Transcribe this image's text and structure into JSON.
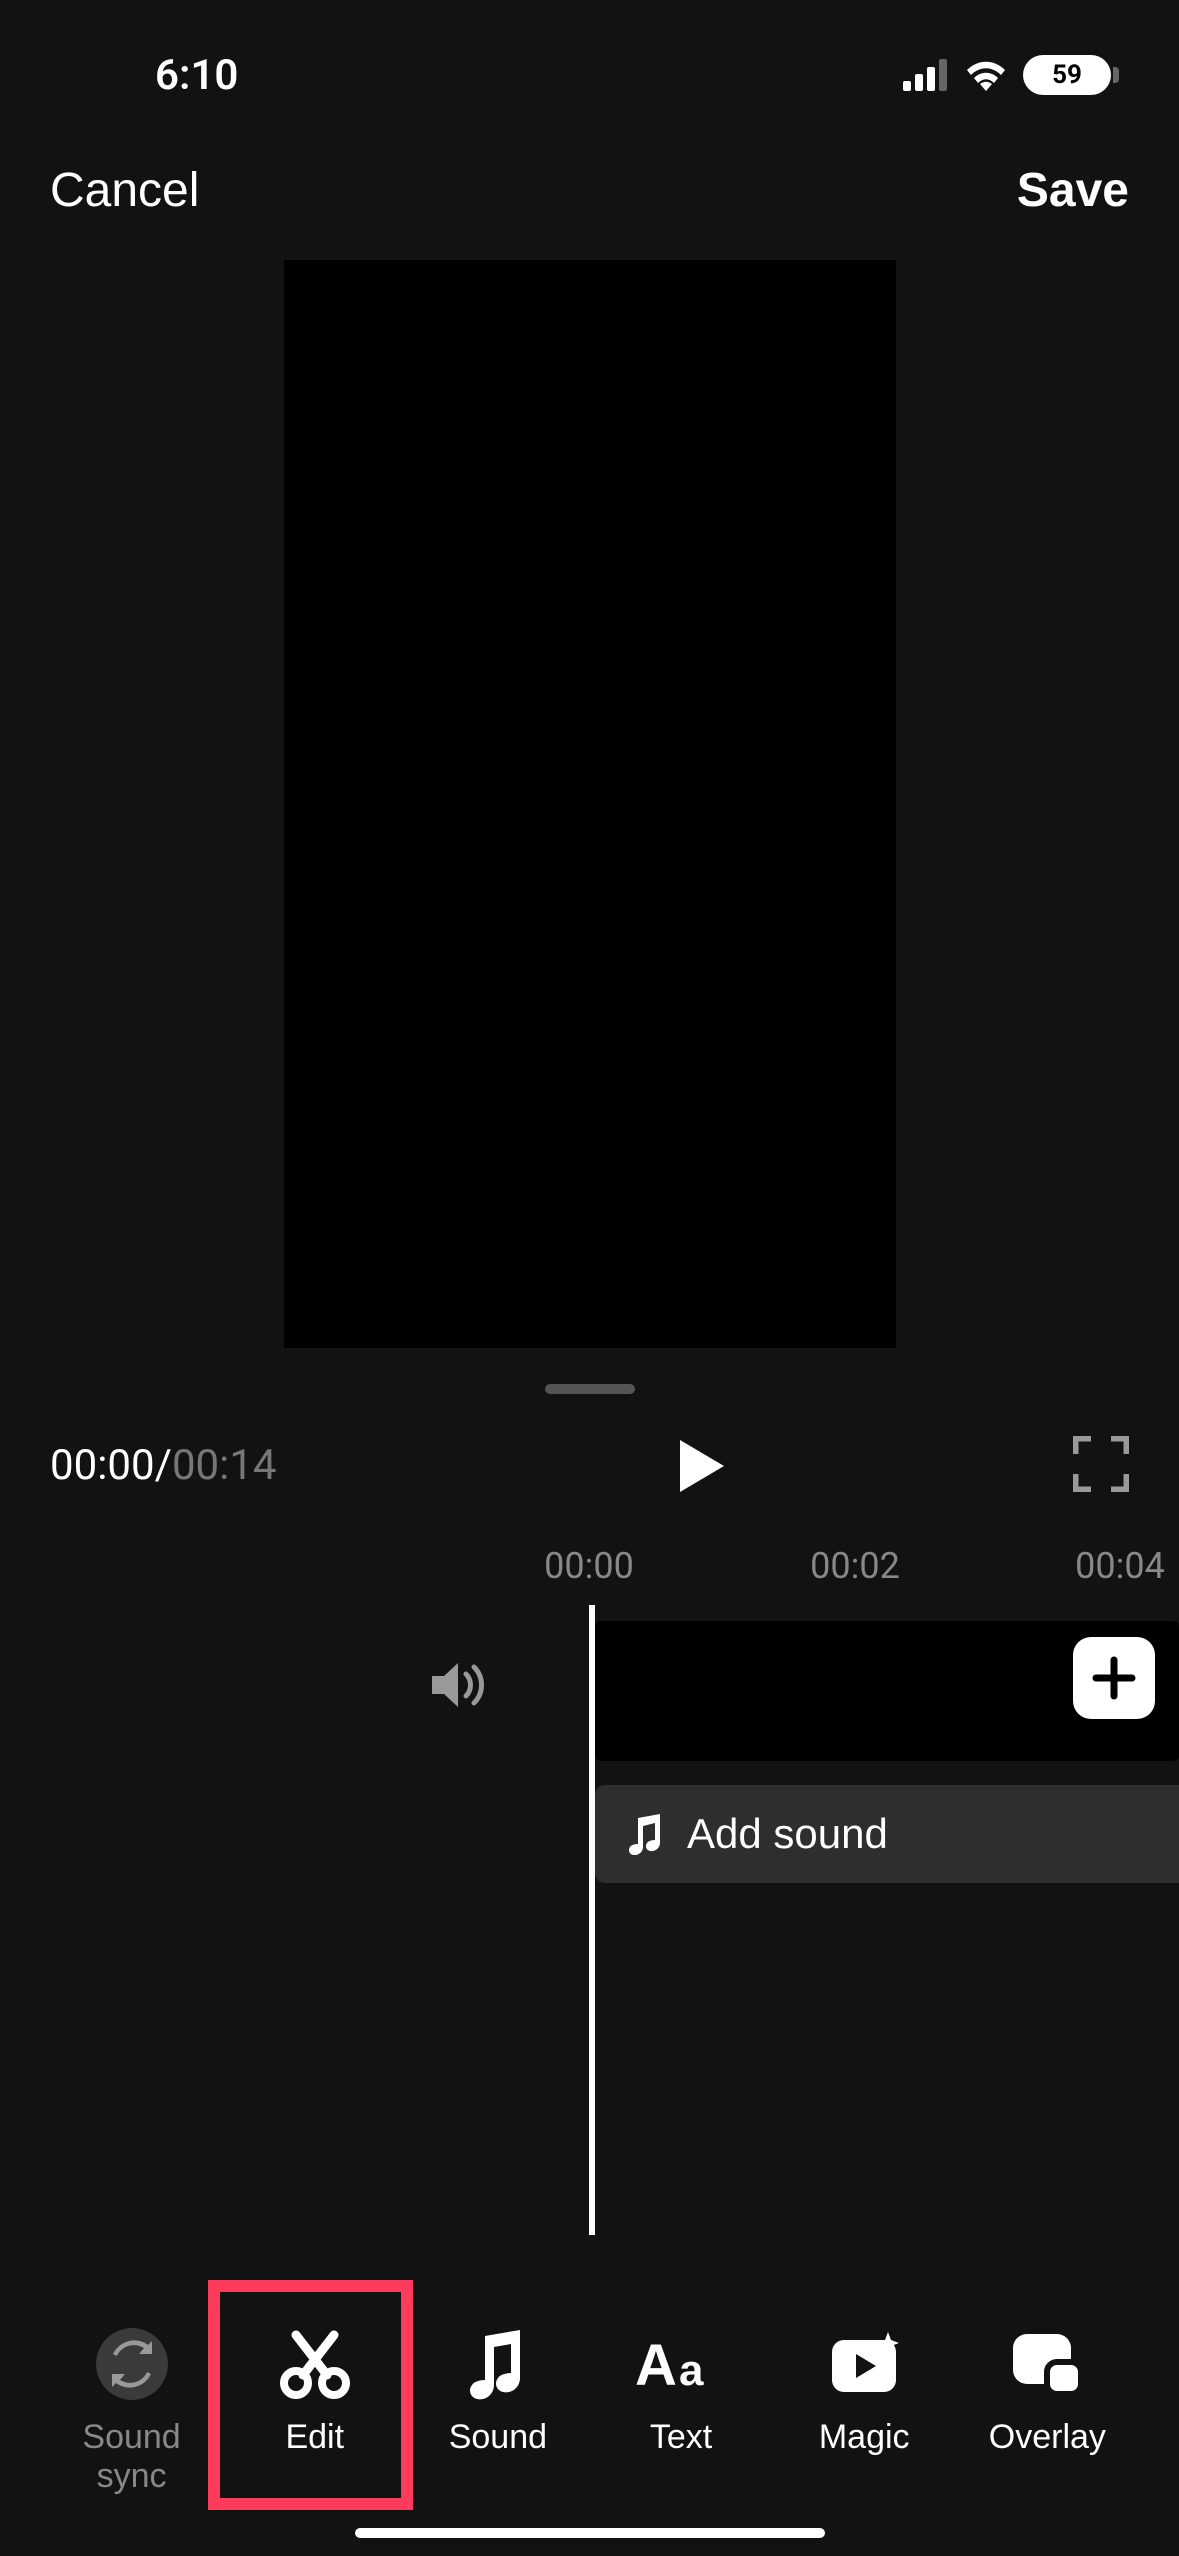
{
  "statusBar": {
    "time": "6:10",
    "battery": "59"
  },
  "header": {
    "cancel": "Cancel",
    "save": "Save"
  },
  "playback": {
    "current": "00:00",
    "separator": "/",
    "total": "00:14"
  },
  "ruler": {
    "t0": "00:00",
    "t1": "00:02",
    "t2": "00:04"
  },
  "timeline": {
    "addSound": "Add sound"
  },
  "tools": {
    "soundSync": "Sound sync",
    "edit": "Edit",
    "sound": "Sound",
    "text": "Text",
    "magic": "Magic",
    "overlay": "Overlay"
  }
}
